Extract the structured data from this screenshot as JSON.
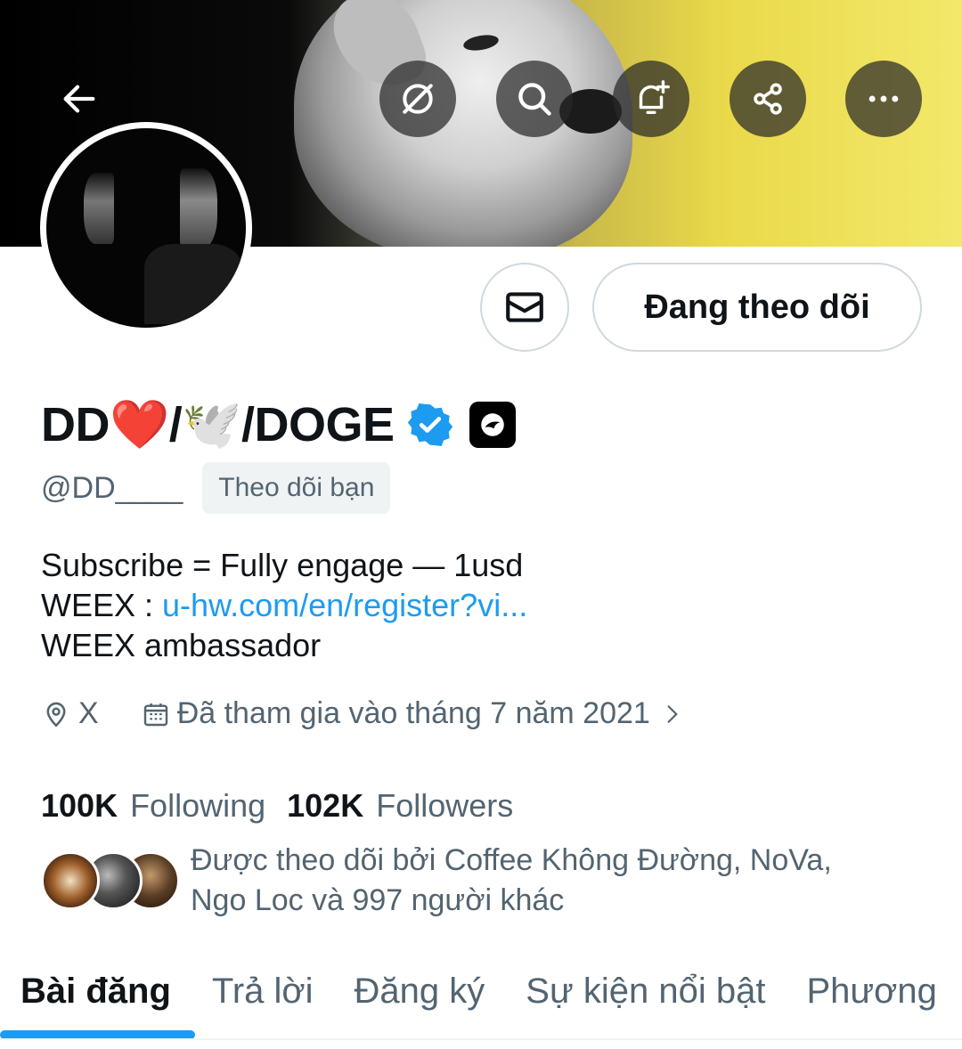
{
  "banner": {
    "description": ""
  },
  "topbar": {
    "back_icon": "arrow-left-icon",
    "buttons": [
      "grok-icon",
      "search-icon",
      "bell-plus-icon",
      "share-icon",
      "more-icon"
    ]
  },
  "profile": {
    "name": "DD❤️/🕊️/DOGE",
    "handle": "@DD____",
    "follows_you": "Theo dõi bạn",
    "follow_button": "Đang theo dõi",
    "bio_line1": "Subscribe = Fully engage — 1usd",
    "bio_line2_prefix": "WEEX : ",
    "bio_link": "u-hw.com/en/register?vi...",
    "bio_line3": "WEEX ambassador",
    "location": "X",
    "joined": "Đã tham gia vào tháng 7 năm 2021"
  },
  "stats": {
    "following_count": "100K",
    "following_label": "Following",
    "followers_count": "102K",
    "followers_label": "Followers"
  },
  "followed_by": {
    "line1": "Được theo dõi bởi Coffee Không Đường, NoVa,",
    "line2": "Ngo Loc và 997 người khác"
  },
  "tabs": [
    {
      "label": "Bài đăng",
      "active": true
    },
    {
      "label": "Trả lời",
      "active": false
    },
    {
      "label": "Đăng ký",
      "active": false
    },
    {
      "label": "Sự kiện nổi bật",
      "active": false
    },
    {
      "label": "Phương",
      "active": false
    }
  ],
  "colors": {
    "accent": "#1d9bf0",
    "text_primary": "#0f1419",
    "text_secondary": "#536471"
  }
}
